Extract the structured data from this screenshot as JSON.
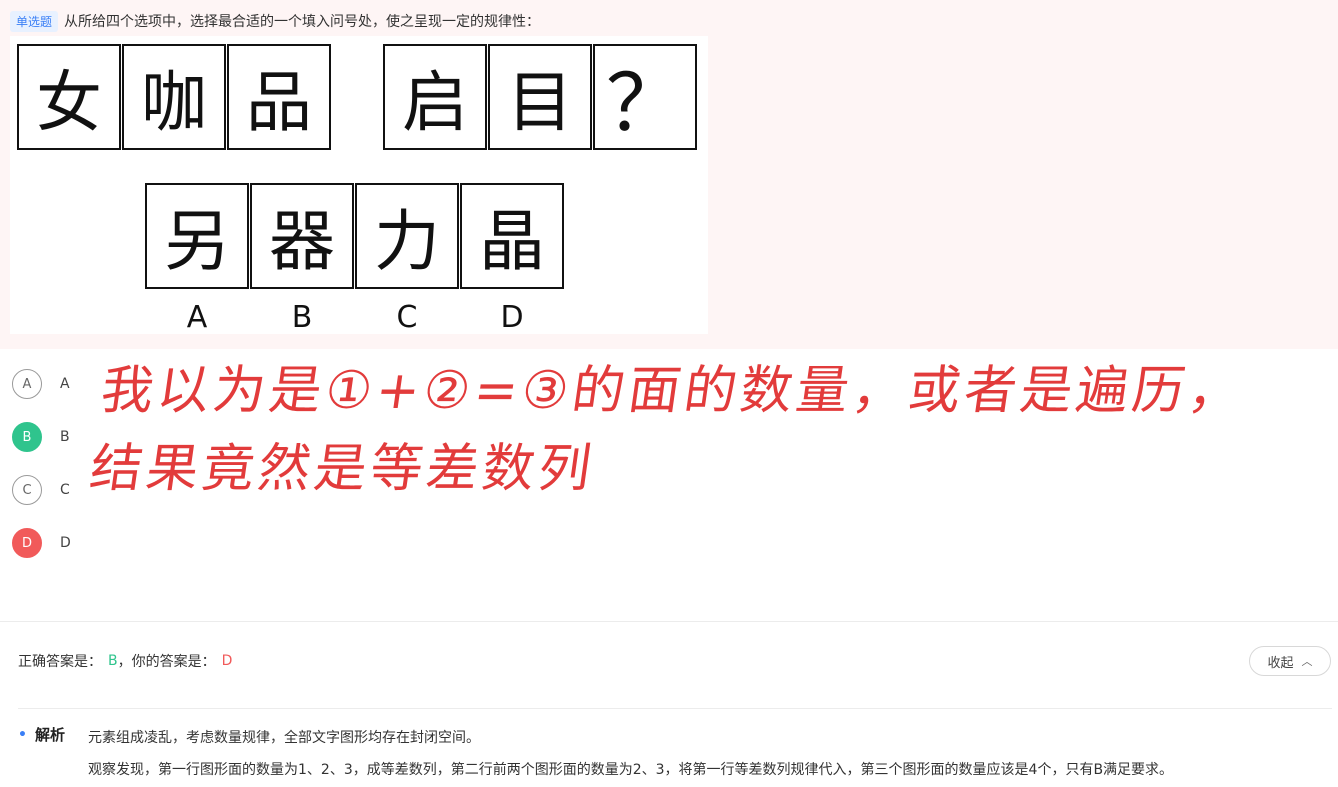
{
  "question": {
    "tag": "单选题",
    "stem": "从所给四个选项中，选择最合适的一个填入问号处，使之呈现一定的规律性："
  },
  "figure": {
    "row1": [
      "女",
      "咖",
      "品"
    ],
    "row2": [
      "启",
      "目",
      "？"
    ],
    "options": [
      "另",
      "器",
      "力",
      "晶"
    ],
    "option_labels": [
      "A",
      "B",
      "C",
      "D"
    ]
  },
  "choices": [
    {
      "letter": "A",
      "label": "A",
      "state": "normal"
    },
    {
      "letter": "B",
      "label": "B",
      "state": "correct"
    },
    {
      "letter": "C",
      "label": "C",
      "state": "normal"
    },
    {
      "letter": "D",
      "label": "D",
      "state": "wrong"
    }
  ],
  "handwriting": {
    "line1": "我以为是①+②=③的面的数量，或者是遍历，",
    "line2": "结果竟然是等差数列"
  },
  "answer": {
    "correct_prefix": "正确答案是：",
    "correct_value": "B",
    "mine_prefix": "，你的答案是：",
    "mine_value": "D",
    "collapse_label": "收起"
  },
  "analysis": {
    "title": "解析",
    "line1": "元素组成凌乱，考虑数量规律，全部文字图形均存在封闭空间。",
    "line2": "观察发现，第一行图形面的数量为1、2、3，成等差数列，第二行前两个图形面的数量为2、3，将第一行等差数列规律代入，第三个图形面的数量应该是4个，只有B满足要求。"
  },
  "colors": {
    "correct": "#2fc48d",
    "wrong": "#f15a5a",
    "accent": "#3a7ff6",
    "handwriting": "#e23b3b"
  }
}
